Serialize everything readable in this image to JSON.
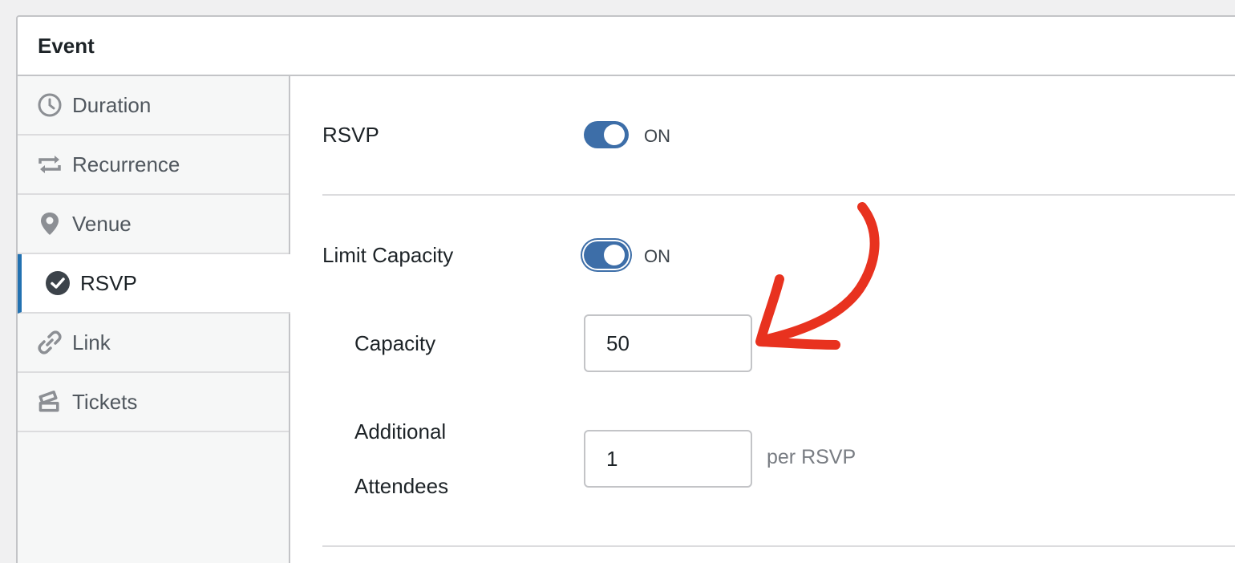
{
  "panel": {
    "title": "Event"
  },
  "sidebar": {
    "items": [
      {
        "label": "Duration",
        "icon": "clock-icon"
      },
      {
        "label": "Recurrence",
        "icon": "repeat-icon"
      },
      {
        "label": "Venue",
        "icon": "location-pin-icon"
      },
      {
        "label": "RSVP",
        "icon": "check-circle-icon",
        "active": true
      },
      {
        "label": "Link",
        "icon": "link-icon"
      },
      {
        "label": "Tickets",
        "icon": "tickets-icon"
      }
    ]
  },
  "rsvp": {
    "label": "RSVP",
    "toggle_state": "ON",
    "limit_capacity": {
      "label": "Limit Capacity",
      "toggle_state": "ON"
    },
    "capacity": {
      "label": "Capacity",
      "value": "50"
    },
    "additional_attendees": {
      "label_line1": "Additional",
      "label_line2": "Attendees",
      "value": "1",
      "suffix": "per RSVP"
    }
  },
  "colors": {
    "accent": "#3d6ea8",
    "annotation_arrow": "#e8321f",
    "active_tab_border": "#2271b1"
  }
}
